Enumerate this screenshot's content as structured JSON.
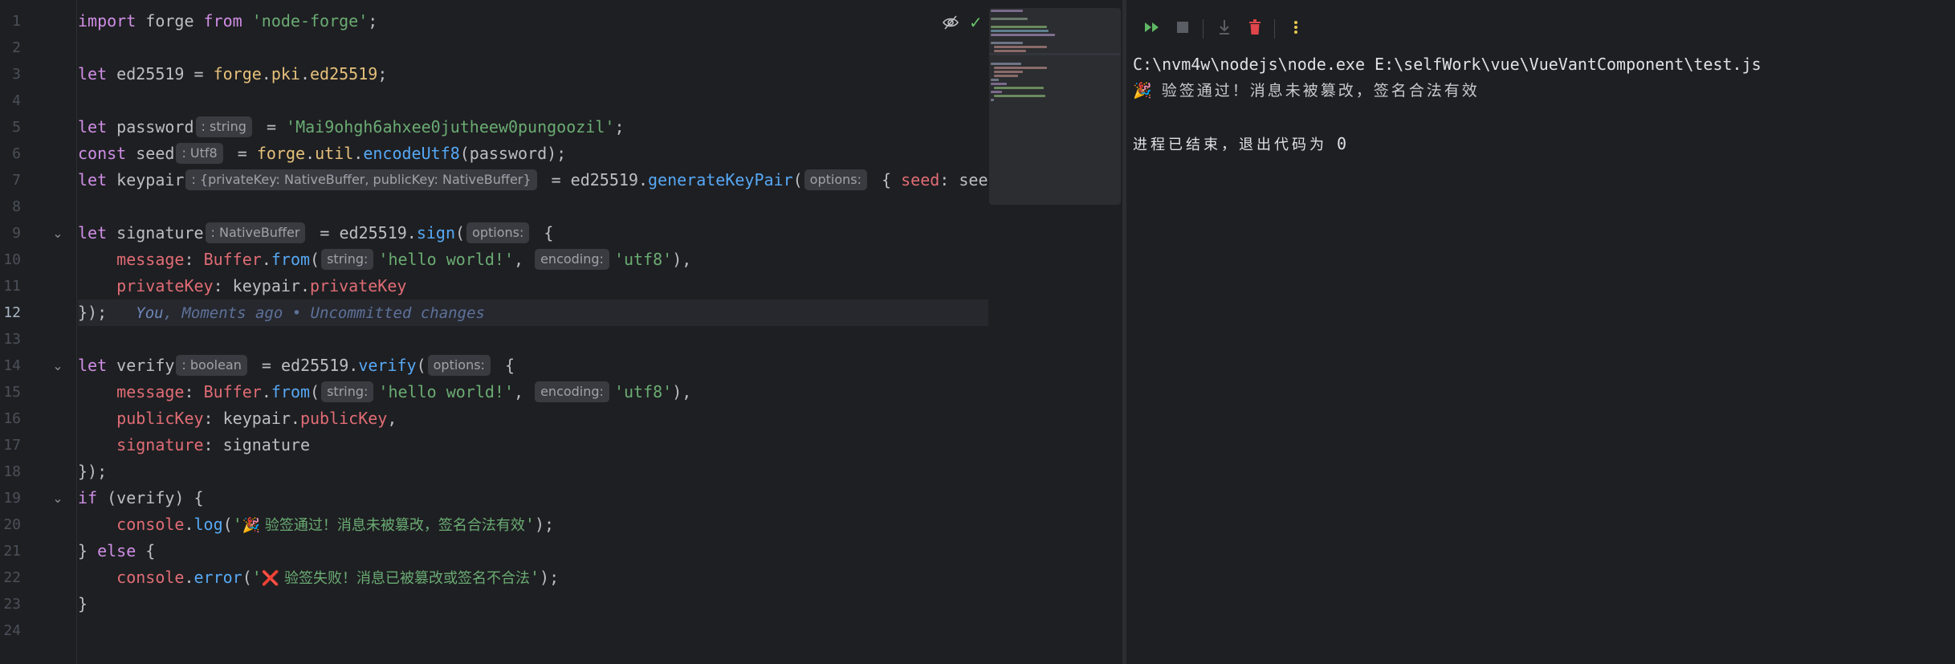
{
  "editor": {
    "line_numbers": [
      "1",
      "2",
      "3",
      "4",
      "5",
      "6",
      "7",
      "8",
      "9",
      "10",
      "11",
      "12",
      "13",
      "14",
      "15",
      "16",
      "17",
      "18",
      "19",
      "20",
      "21",
      "22",
      "23",
      "24"
    ],
    "active_line": "12",
    "line1": {
      "import": "import",
      "forge": " forge ",
      "from": "from",
      "module": " 'node-forge'",
      "semi": ";"
    },
    "line3": {
      "let": "let",
      "var": " ed25519 = ",
      "forge": "forge",
      "dot1": ".",
      "pki": "pki",
      "dot2": ".",
      "ed": "ed25519",
      "semi": ";"
    },
    "line5": {
      "let": "let",
      "var": " password",
      "hint": ": string",
      "eq": " = ",
      "value": "'Mai9ohgh6ahxee0jutheew0pungoozil'",
      "semi": ";"
    },
    "line6": {
      "const": "const",
      "var": " seed",
      "hint": ": Utf8",
      "eq": " = ",
      "forge": "forge",
      "dot1": ".",
      "util": "util",
      "dot2": ".",
      "fn": "encodeUtf8",
      "args": "(password);"
    },
    "line7": {
      "let": "let",
      "var": " keypair",
      "hint": ": {privateKey: NativeBuffer, publicKey: NativeBuffer}",
      "eq": " = ed25519.",
      "fn": "generateKeyPair",
      "open": "(",
      "param_hint": "options:",
      "brace": " { ",
      "seed": "seed",
      "rest": ": see"
    },
    "line9": {
      "let": "let",
      "var": " signature",
      "hint": ": NativeBuffer",
      "eq": " = ed25519.",
      "fn": "sign",
      "open": "(",
      "param_hint": "options:",
      "brace": " {"
    },
    "line10": {
      "indent": "    ",
      "message": "message",
      "colon": ": ",
      "buffer": "Buffer",
      "dot": ".",
      "from": "from",
      "open": "(",
      "param_hint": "string:",
      "text": "'hello world!'",
      "comma": ", ",
      "param_hint2": "encoding:",
      "enc": "'utf8'",
      "close": "),"
    },
    "line11": {
      "indent": "    ",
      "privateKey": "privateKey",
      "colon": ": keypair.",
      "value": "privateKey"
    },
    "line12": {
      "close": "});",
      "blame_you": "You",
      "blame_rest": ", Moments ago • Uncommitted changes"
    },
    "line14": {
      "let": "let",
      "var": " verify",
      "hint": ": boolean",
      "eq": " = ed25519.",
      "fn": "verify",
      "open": "(",
      "param_hint": "options:",
      "brace": " {"
    },
    "line15": {
      "indent": "    ",
      "message": "message",
      "colon": ": ",
      "buffer": "Buffer",
      "dot": ".",
      "from": "from",
      "open": "(",
      "param_hint": "string:",
      "text": "'hello world!'",
      "comma": ", ",
      "param_hint2": "encoding:",
      "enc": "'utf8'",
      "close": "),"
    },
    "line16": {
      "indent": "    ",
      "publicKey": "publicKey",
      "colon": ": keypair.",
      "value": "publicKey",
      "comma": ","
    },
    "line17": {
      "indent": "    ",
      "signature": "signature",
      "rest": ": signature"
    },
    "line18": {
      "close": "});"
    },
    "line19": {
      "if": "if",
      "rest": " (verify) {"
    },
    "line20": {
      "indent": "    ",
      "console": "console",
      "dot": ".",
      "fn": "log",
      "open": "(",
      "str_open": "'",
      "emoji": "🎉",
      "msg": " 验签通过！消息未被篡改，签名合法有效",
      "str_close": "'",
      "close": ");"
    },
    "line21": {
      "close": "} ",
      "else": "else",
      "brace": " {"
    },
    "line22": {
      "indent": "    ",
      "console": "console",
      "dot": ".",
      "fn": "error",
      "open": "(",
      "str_open": "'",
      "emoji": "❌",
      "msg": " 验签失败！消息已被篡改或签名不合法",
      "str_close": "'",
      "close": ");"
    },
    "line23": {
      "close": "}"
    }
  },
  "icons": {
    "hide": "eye-off-icon",
    "check": "checkmark-icon",
    "rerun": "rerun-icon",
    "stop": "stop-icon",
    "scroll_end": "scroll-to-end-icon",
    "clear": "trash-icon",
    "more": "more-vertical-icon"
  },
  "colors": {
    "background": "#1e1f22",
    "keyword": "#cf8ee5",
    "string": "#6aab73",
    "function": "#56a8f5",
    "property": "#e06c75",
    "class": "#e5c07b",
    "run_green": "#5fb865",
    "delete_red": "#e0454c",
    "more_yellow": "#e6c84f"
  },
  "run_panel": {
    "command": "C:\\nvm4w\\nodejs\\node.exe E:\\selfWork\\vue\\VueVantComponent\\test.js",
    "output_emoji": "🎉",
    "output_text": " 验签通过！消息未被篡改，签名合法有效",
    "exit_text": "进程已结束，退出代码为",
    "exit_code": " 0"
  }
}
